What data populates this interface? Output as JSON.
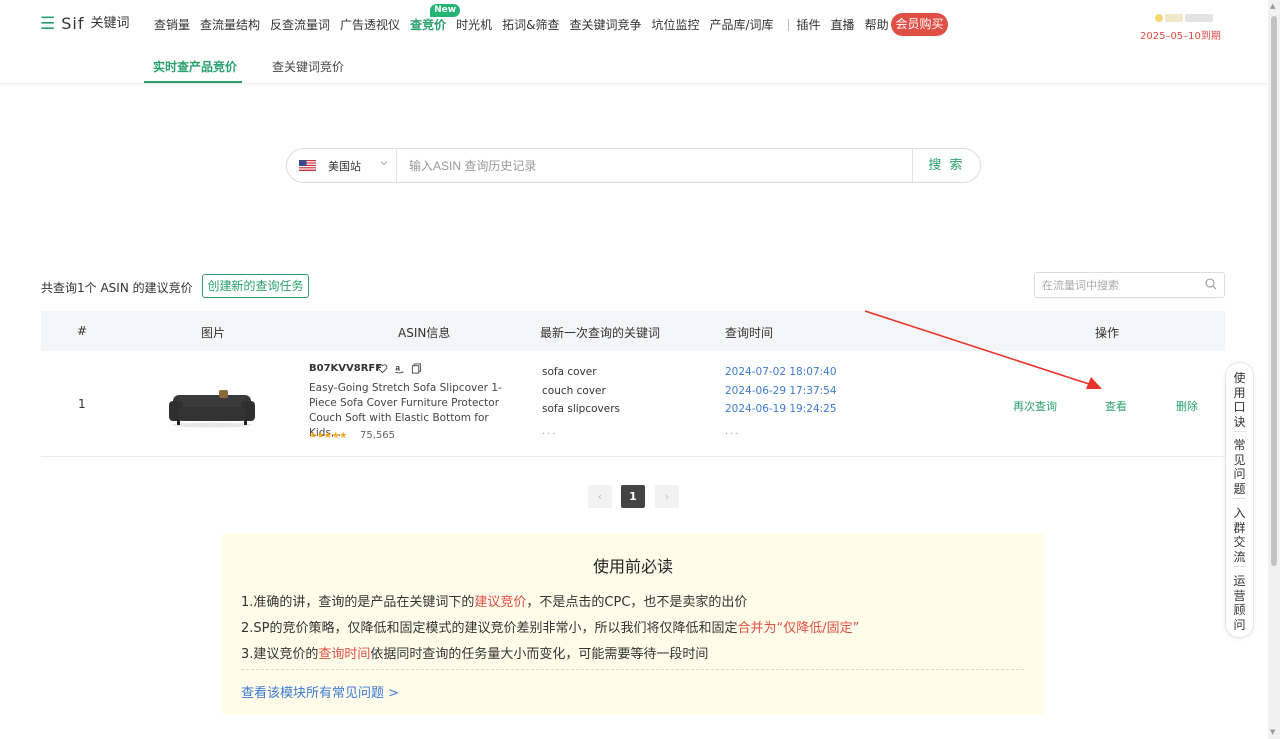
{
  "nav": {
    "brand": "Sif",
    "brand_cn": "关键词",
    "items": [
      "查销量",
      "查流量结构",
      "反查流量词",
      "广告透视仪",
      "查竞价",
      "时光机",
      "拓词&筛查",
      "查关键词竞争",
      "坑位监控",
      "产品库/词库"
    ],
    "new_badge": "New",
    "items_right": [
      "插件",
      "直播",
      "帮助"
    ],
    "vip_label": "会员购买",
    "expire_text": "2025–05–10到期"
  },
  "subtabs": [
    "实时查产品竞价",
    "查关键词竞价"
  ],
  "search": {
    "site": "美国站",
    "placeholder": "输入ASIN 查询历史记录",
    "button": "搜 索"
  },
  "results": {
    "count_text": "共查询1个 ASIN 的建议竞价",
    "create_button": "创建新的查询任务",
    "filter_placeholder": "在流量词中搜索"
  },
  "table": {
    "headers": [
      "#",
      "图片",
      "ASIN信息",
      "最新一次查询的关键词",
      "查询时间",
      "操作"
    ],
    "rows": [
      {
        "index": "1",
        "asin": "B07KVV8RFF",
        "title": "Easy-Going Stretch Sofa Slipcover 1-Piece Sofa Cover Furniture Protector Couch Soft with Elastic Bottom for Kids,...",
        "stars": "★★★★★",
        "rating_count": "75,565",
        "keywords": [
          "sofa cover",
          "couch cover",
          "sofa slipcovers"
        ],
        "times": [
          "2024-07-02 18:07:40",
          "2024-06-29 17:37:54",
          "2024-06-19 19:24:25"
        ],
        "more": "···",
        "actions": [
          "再次查询",
          "查看",
          "删除"
        ]
      }
    ]
  },
  "pagination": {
    "prev": "‹",
    "current": "1",
    "next": "›"
  },
  "notice": {
    "title": "使用前必读",
    "line1_a": "1.准确的讲，查询的是产品在关键词下的",
    "line1_hl": "建议竞价",
    "line1_b": "，不是点击的CPC，也不是卖家的出价",
    "line2_a": "2.SP的竞价策略，仅降低和固定模式的建议竞价差别非常小，所以我们将仅降低和固定",
    "line2_hl": "合并为“仅降低/固定”",
    "line3_a": "3.建议竞价的",
    "line3_hl": "查询时间",
    "line3_b": "依据同时查询的任务量大小而变化，可能需要等待一段时间",
    "link": "查看该模块所有常见问题 >"
  },
  "float_tools": [
    "使用口诀",
    "常见问题",
    "入群交流",
    "运营顾问"
  ],
  "colors": {
    "accent": "#2aa16d",
    "danger": "#e04f45",
    "link": "#3b7bd6"
  }
}
